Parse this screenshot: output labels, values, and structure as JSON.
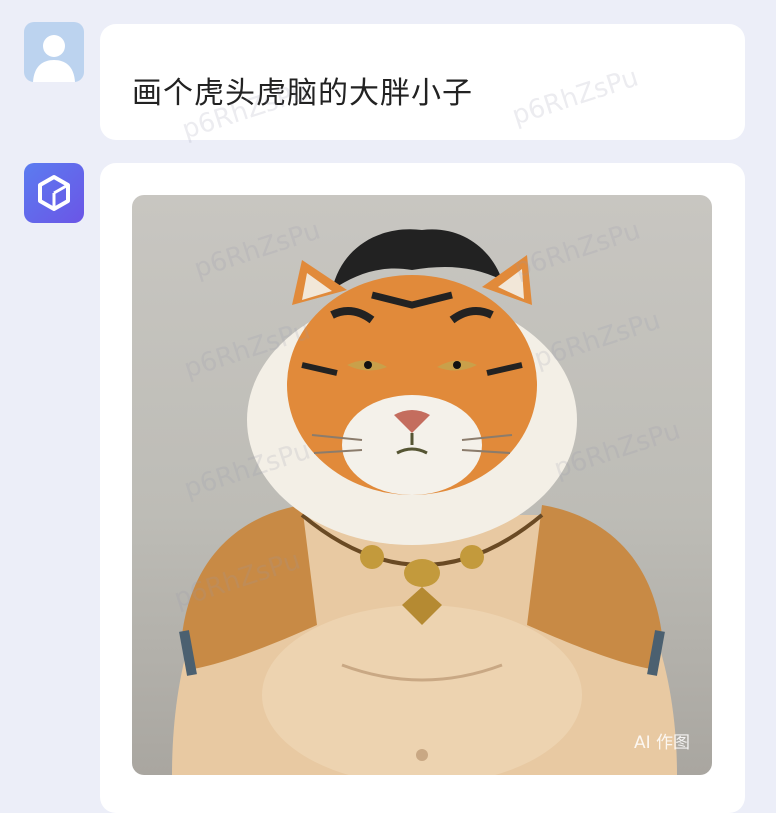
{
  "user_message": {
    "text": "画个虎头虎脑的大胖小子"
  },
  "bot_message": {
    "image_badge": "AI 作图"
  },
  "watermark": "p6RhZsPu",
  "colors": {
    "page_bg": "#eceef8",
    "bubble_bg": "#ffffff",
    "bot_avatar": "#6b55e6",
    "user_avatar": "#bcd3ef"
  }
}
